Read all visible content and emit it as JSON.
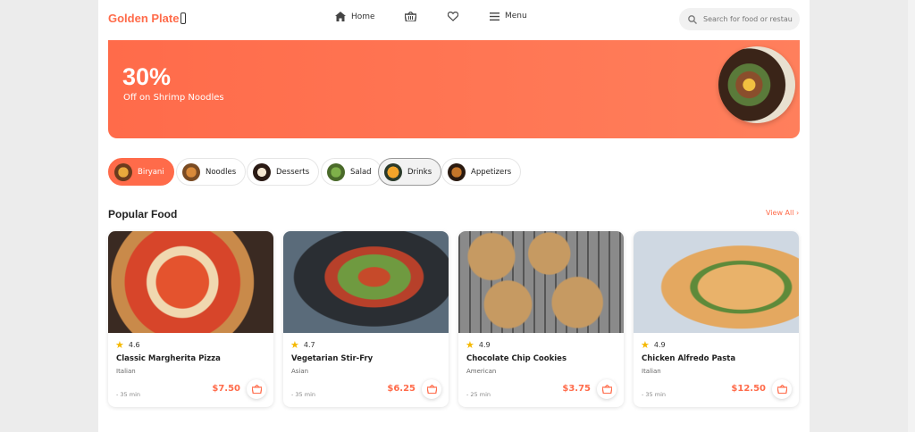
{
  "brand": {
    "name": "Golden Plate",
    "accent": "#ff6b4a"
  },
  "nav": {
    "home": "Home",
    "menu": "Menu"
  },
  "search": {
    "placeholder": "Search for food or restaurants"
  },
  "banner": {
    "percent": "30%",
    "subtitle": "Off on Shrimp Noodles"
  },
  "categories": [
    {
      "label": "Biryani",
      "active": true
    },
    {
      "label": "Noodles"
    },
    {
      "label": "Desserts"
    },
    {
      "label": "Salad"
    },
    {
      "label": "Drinks",
      "hovered": true
    },
    {
      "label": "Appetizers"
    }
  ],
  "popular": {
    "title": "Popular Food",
    "view_all": "View All ›",
    "items": [
      {
        "rating": "4.6",
        "name": "Classic Margherita Pizza",
        "cuisine": "Italian",
        "time": "- 35 min",
        "price": "$7.50"
      },
      {
        "rating": "4.7",
        "name": "Vegetarian Stir-Fry",
        "cuisine": "Asian",
        "time": "- 35 min",
        "price": "$6.25"
      },
      {
        "rating": "4.9",
        "name": "Chocolate Chip Cookies",
        "cuisine": "American",
        "time": "- 25 min",
        "price": "$3.75"
      },
      {
        "rating": "4.9",
        "name": "Chicken Alfredo Pasta",
        "cuisine": "Italian",
        "time": "- 35 min",
        "price": "$12.50"
      }
    ]
  }
}
